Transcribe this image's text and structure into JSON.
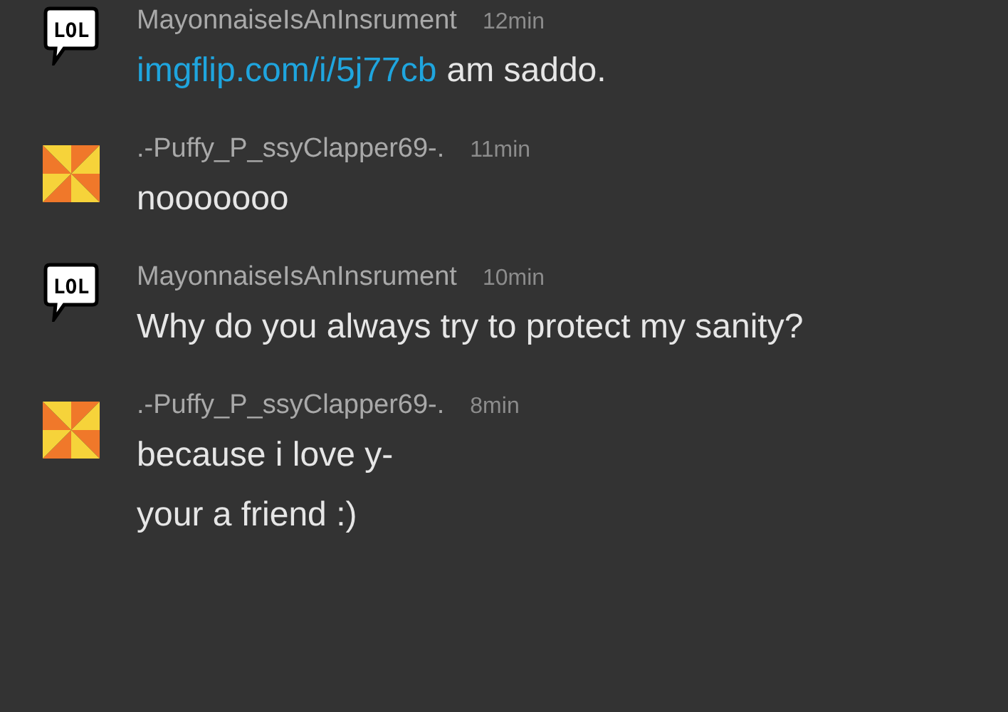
{
  "messages": [
    {
      "avatar": {
        "kind": "bubble",
        "label": "LOL"
      },
      "author": "MayonnaiseIsAnInsrument",
      "time": "12min",
      "lines": [
        [
          {
            "kind": "link",
            "text": "imgflip.com/i/5j77cb"
          },
          {
            "kind": "text",
            "text": "am saddo."
          }
        ]
      ]
    },
    {
      "avatar": {
        "kind": "pinwheel"
      },
      "author": ".-Puffy_P_ssyClapper69-.",
      "time": "11min",
      "lines": [
        [
          {
            "kind": "text",
            "text": "nooooooo"
          }
        ]
      ]
    },
    {
      "avatar": {
        "kind": "bubble",
        "label": "LOL"
      },
      "author": "MayonnaiseIsAnInsrument",
      "time": "10min",
      "lines": [
        [
          {
            "kind": "text",
            "text": "Why do you always try to protect my sanity?"
          }
        ]
      ]
    },
    {
      "avatar": {
        "kind": "pinwheel"
      },
      "author": ".-Puffy_P_ssyClapper69-.",
      "time": "8min",
      "lines": [
        [
          {
            "kind": "text",
            "text": "because i love y-"
          }
        ],
        [
          {
            "kind": "text",
            "text": "your a friend :)"
          }
        ]
      ]
    }
  ]
}
